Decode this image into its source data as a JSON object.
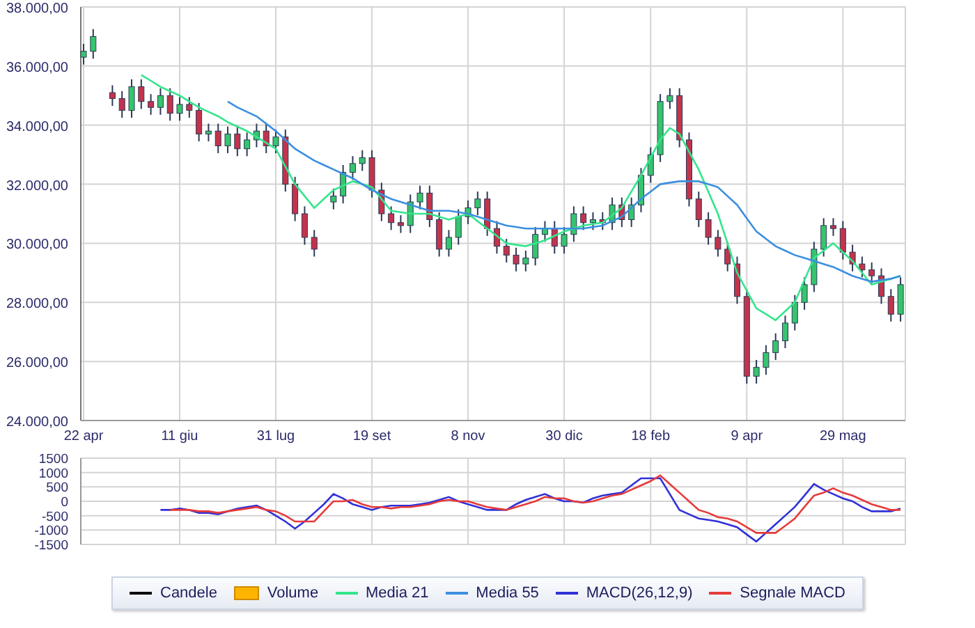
{
  "price_chart": {
    "chart_data": {
      "type": "candlestick",
      "categories": [
        "22 apr",
        null,
        null,
        null,
        null,
        null,
        null,
        null,
        null,
        null,
        "11 giu",
        null,
        null,
        null,
        null,
        null,
        null,
        null,
        null,
        null,
        "31 lug",
        null,
        null,
        null,
        null,
        null,
        null,
        null,
        null,
        null,
        "19 set",
        null,
        null,
        null,
        null,
        null,
        null,
        null,
        null,
        null,
        "8 nov",
        null,
        null,
        null,
        null,
        null,
        null,
        null,
        null,
        null,
        "30 dic",
        null,
        null,
        null,
        null,
        null,
        null,
        null,
        null,
        "18 feb",
        null,
        null,
        null,
        null,
        null,
        null,
        null,
        null,
        null,
        "9 apr",
        null,
        null,
        null,
        null,
        null,
        null,
        null,
        null,
        null,
        "29 mag",
        null,
        null,
        null,
        null,
        null,
        null
      ],
      "ylim": [
        24000,
        38000
      ],
      "yticks": [
        {
          "value": 24000,
          "label": "24.000,00"
        },
        {
          "value": 26000,
          "label": "26.000,00"
        },
        {
          "value": 28000,
          "label": "28.000,00"
        },
        {
          "value": 30000,
          "label": "30.000,00"
        },
        {
          "value": 32000,
          "label": "32.000,00"
        },
        {
          "value": 34000,
          "label": "34.000,00"
        },
        {
          "value": 36000,
          "label": "36.000,00"
        },
        {
          "value": 38000,
          "label": "38.000,00"
        }
      ],
      "ohlc": [
        [
          36300,
          36750,
          36050,
          36500
        ],
        [
          36500,
          37250,
          36250,
          37000
        ],
        null,
        [
          35100,
          35350,
          34650,
          34900
        ],
        [
          34900,
          35150,
          34250,
          34500
        ],
        [
          34500,
          35550,
          34250,
          35300
        ],
        [
          35300,
          35550,
          34550,
          34800
        ],
        [
          34800,
          35050,
          34350,
          34600
        ],
        [
          34600,
          35250,
          34350,
          35000
        ],
        [
          35000,
          35250,
          34150,
          34400
        ],
        [
          34400,
          34950,
          34150,
          34700
        ],
        [
          34700,
          34950,
          34250,
          34500
        ],
        [
          34500,
          34750,
          33450,
          33700
        ],
        [
          33700,
          34050,
          33450,
          33800
        ],
        [
          33800,
          34050,
          33050,
          33300
        ],
        [
          33300,
          33950,
          33050,
          33700
        ],
        [
          33700,
          33950,
          32950,
          33200
        ],
        [
          33200,
          33750,
          32950,
          33500
        ],
        [
          33500,
          34050,
          33250,
          33800
        ],
        [
          33800,
          34050,
          33050,
          33300
        ],
        [
          33300,
          33850,
          33050,
          33600
        ],
        [
          33600,
          33850,
          31750,
          32000
        ],
        [
          32000,
          32250,
          30750,
          31000
        ],
        [
          31000,
          31250,
          29950,
          30200
        ],
        [
          30200,
          30450,
          29550,
          29800
        ],
        null,
        [
          31400,
          31850,
          31150,
          31600
        ],
        [
          31600,
          32650,
          31350,
          32400
        ],
        [
          32400,
          32950,
          32150,
          32700
        ],
        [
          32700,
          33150,
          32450,
          32900
        ],
        [
          32900,
          33150,
          31550,
          31800
        ],
        [
          31800,
          32050,
          30750,
          31000
        ],
        [
          31000,
          31250,
          30450,
          30700
        ],
        [
          30700,
          30950,
          30350,
          30600
        ],
        [
          30600,
          31650,
          30350,
          31400
        ],
        [
          31400,
          31950,
          31150,
          31700
        ],
        [
          31700,
          31950,
          30550,
          30800
        ],
        [
          30800,
          31050,
          29550,
          29800
        ],
        [
          29800,
          30450,
          29550,
          30200
        ],
        [
          30200,
          31150,
          29950,
          30900
        ],
        [
          30900,
          31450,
          30650,
          31200
        ],
        [
          31200,
          31750,
          30950,
          31500
        ],
        [
          31500,
          31750,
          30250,
          30500
        ],
        [
          30500,
          30750,
          29650,
          29900
        ],
        [
          29900,
          30150,
          29350,
          29600
        ],
        [
          29600,
          29850,
          29050,
          29300
        ],
        [
          29300,
          29750,
          29050,
          29500
        ],
        [
          29500,
          30550,
          29250,
          30300
        ],
        [
          30300,
          30750,
          30050,
          30500
        ],
        [
          30500,
          30750,
          29650,
          29900
        ],
        [
          29900,
          30550,
          29650,
          30300
        ],
        [
          30300,
          31250,
          30050,
          31000
        ],
        [
          31000,
          31250,
          30450,
          30700
        ],
        [
          30700,
          31050,
          30450,
          30800
        ],
        [
          30800,
          31050,
          30450,
          30700
        ],
        [
          30700,
          31550,
          30450,
          31300
        ],
        [
          31300,
          31550,
          30550,
          30800
        ],
        [
          30800,
          31550,
          30550,
          31300
        ],
        [
          31300,
          32550,
          31050,
          32300
        ],
        [
          32300,
          33250,
          32050,
          33000
        ],
        [
          33000,
          35050,
          32750,
          34800
        ],
        [
          34800,
          35250,
          34550,
          35000
        ],
        [
          35000,
          35250,
          33250,
          33500
        ],
        [
          33500,
          33750,
          31250,
          31500
        ],
        [
          31500,
          31750,
          30550,
          30800
        ],
        [
          30800,
          31050,
          29950,
          30200
        ],
        [
          30200,
          30450,
          29550,
          29800
        ],
        [
          29800,
          30050,
          29050,
          29300
        ],
        [
          29300,
          29550,
          27950,
          28200
        ],
        [
          28200,
          28450,
          25250,
          25500
        ],
        [
          25500,
          26050,
          25250,
          25800
        ],
        [
          25800,
          26550,
          25550,
          26300
        ],
        [
          26300,
          26950,
          26050,
          26700
        ],
        [
          26700,
          27550,
          26450,
          27300
        ],
        [
          27300,
          28250,
          27050,
          28000
        ],
        [
          28000,
          28850,
          27750,
          28600
        ],
        [
          28600,
          30050,
          28350,
          29800
        ],
        [
          29800,
          30850,
          29550,
          30600
        ],
        [
          30600,
          30850,
          30250,
          30500
        ],
        [
          30500,
          30750,
          29450,
          29700
        ],
        [
          29700,
          29950,
          29050,
          29300
        ],
        [
          29300,
          29550,
          28850,
          29100
        ],
        [
          29100,
          29350,
          28650,
          28900
        ],
        [
          28900,
          29150,
          27950,
          28200
        ],
        [
          28200,
          28450,
          27350,
          27600
        ],
        [
          27600,
          28850,
          27350,
          28600
        ]
      ],
      "grid": true
    }
  },
  "moving_averages": {
    "chart_data": {
      "type": "line",
      "categories": [
        null,
        null,
        null,
        null,
        null,
        null,
        null,
        null,
        null,
        null,
        null,
        null,
        null,
        null,
        null,
        null,
        null,
        null,
        null,
        null,
        null,
        null,
        null,
        null,
        null,
        null,
        null,
        null,
        null,
        null,
        null,
        null,
        null,
        null,
        null,
        null,
        null,
        null,
        null,
        null,
        null,
        null,
        null,
        null,
        null,
        null,
        null,
        null,
        null,
        null,
        null,
        null,
        null,
        null,
        null,
        null,
        null,
        null,
        null,
        null,
        null,
        null,
        null,
        null,
        null,
        null,
        null,
        null,
        null,
        null,
        null,
        null,
        null,
        null,
        null,
        null,
        null,
        null,
        null,
        null,
        null,
        null,
        null,
        null,
        null,
        null
      ],
      "ylim": [
        24000,
        38000
      ],
      "series": [
        {
          "name": "Media 21",
          "color": "#33e68c",
          "values": [
            null,
            null,
            null,
            null,
            null,
            null,
            35700,
            35500,
            35300,
            35150,
            35000,
            34800,
            34600,
            34450,
            34300,
            34100,
            33950,
            33800,
            33600,
            33400,
            33200,
            32600,
            32000,
            31600,
            31200,
            31500,
            31800,
            31950,
            32100,
            32000,
            31900,
            31500,
            31100,
            31050,
            31000,
            31000,
            31000,
            30900,
            30800,
            30900,
            31000,
            30750,
            30500,
            30250,
            30000,
            29950,
            29900,
            30000,
            30100,
            30250,
            30400,
            30500,
            30600,
            30650,
            30700,
            30950,
            31200,
            31750,
            32300,
            32900,
            33500,
            33900,
            33700,
            33100,
            32500,
            31750,
            31000,
            30000,
            29000,
            28400,
            27800,
            27600,
            27400,
            27700,
            28000,
            28750,
            29500,
            29750,
            30000,
            29700,
            29400,
            29000,
            28600,
            28700,
            28800,
            28900
          ]
        },
        {
          "name": "Media 55",
          "color": "#3b8fe0",
          "values": [
            null,
            null,
            null,
            null,
            null,
            null,
            null,
            null,
            null,
            null,
            null,
            null,
            null,
            null,
            null,
            34800,
            34600,
            34450,
            34300,
            34050,
            33800,
            33500,
            33200,
            33000,
            32800,
            32650,
            32500,
            32350,
            32200,
            32000,
            31800,
            31650,
            31500,
            31400,
            31300,
            31200,
            31100,
            31100,
            31100,
            31050,
            31000,
            30900,
            30800,
            30700,
            30600,
            30550,
            30500,
            30500,
            30500,
            30500,
            30500,
            30500,
            30500,
            30550,
            30600,
            30750,
            30900,
            31200,
            31500,
            31750,
            32000,
            32050,
            32100,
            32100,
            32100,
            32000,
            31900,
            31600,
            31300,
            30850,
            30400,
            30150,
            29900,
            29750,
            29600,
            29500,
            29400,
            29300,
            29200,
            29050,
            28900,
            28800,
            28700,
            28750,
            28800,
            28900
          ]
        }
      ]
    }
  },
  "macd_chart": {
    "chart_data": {
      "type": "line",
      "categories": [
        null,
        null,
        null,
        null,
        null,
        null,
        null,
        null,
        null,
        null,
        null,
        null,
        null,
        null,
        null,
        null,
        null,
        null,
        null,
        null,
        null,
        null,
        null,
        null,
        null,
        null,
        null,
        null,
        null,
        null,
        null,
        null,
        null,
        null,
        null,
        null,
        null,
        null,
        null,
        null,
        null,
        null,
        null,
        null,
        null,
        null,
        null,
        null,
        null,
        null,
        null,
        null,
        null,
        null,
        null,
        null,
        null,
        null,
        null,
        null,
        null,
        null,
        null,
        null,
        null,
        null,
        null,
        null,
        null,
        null,
        null,
        null,
        null,
        null,
        null,
        null,
        null,
        null,
        null,
        null,
        null,
        null,
        null,
        null,
        null,
        null
      ],
      "ylim": [
        -1500,
        1500
      ],
      "grid": true,
      "yticks": [
        {
          "value": 1500,
          "label": "1500"
        },
        {
          "value": 1000,
          "label": "1000"
        },
        {
          "value": 500,
          "label": "500"
        },
        {
          "value": 0,
          "label": "0"
        },
        {
          "value": -500,
          "label": "-500"
        },
        {
          "value": -1000,
          "label": "-1000"
        },
        {
          "value": -1500,
          "label": "-1500"
        }
      ],
      "series": [
        {
          "name": "MACD(26,12,9)",
          "color": "#3030d8",
          "values": [
            null,
            null,
            null,
            null,
            null,
            null,
            null,
            null,
            -300,
            -300,
            -250,
            -300,
            -400,
            -400,
            -450,
            -350,
            -250,
            -200,
            -150,
            -300,
            -500,
            -700,
            -950,
            -700,
            -400,
            -100,
            250,
            100,
            -100,
            -200,
            -300,
            -200,
            -150,
            -150,
            -150,
            -100,
            -50,
            50,
            150,
            0,
            -100,
            -200,
            -300,
            -300,
            -300,
            -100,
            50,
            150,
            250,
            100,
            0,
            0,
            -50,
            100,
            200,
            250,
            300,
            550,
            800,
            800,
            800,
            250,
            -300,
            -450,
            -600,
            -650,
            -700,
            -800,
            -900,
            -1150,
            -1400,
            -1100,
            -800,
            -500,
            -200,
            200,
            600,
            400,
            250,
            100,
            0,
            -200,
            -350,
            -350,
            -350,
            -250
          ]
        },
        {
          "name": "Segnale MACD",
          "color": "#e53a3a",
          "values": [
            null,
            null,
            null,
            null,
            null,
            null,
            null,
            null,
            null,
            -300,
            -300,
            -300,
            -350,
            -350,
            -400,
            -350,
            -300,
            -250,
            -200,
            -300,
            -350,
            -500,
            -700,
            -700,
            -700,
            -350,
            0,
            0,
            50,
            -100,
            -200,
            -200,
            -250,
            -200,
            -200,
            -150,
            -100,
            0,
            50,
            0,
            0,
            -100,
            -200,
            -250,
            -300,
            -200,
            -100,
            0,
            150,
            100,
            100,
            0,
            -50,
            0,
            100,
            200,
            250,
            400,
            550,
            700,
            900,
            600,
            300,
            0,
            -300,
            -400,
            -550,
            -600,
            -700,
            -900,
            -1100,
            -1100,
            -1100,
            -850,
            -600,
            -200,
            200,
            300,
            450,
            300,
            200,
            50,
            -100,
            -200,
            -300,
            -300
          ]
        }
      ]
    }
  },
  "legend": [
    {
      "label": "Candele",
      "kind": "line",
      "color": "#000000"
    },
    {
      "label": "Volume",
      "kind": "box",
      "color": "#ffb400"
    }
  ]
}
